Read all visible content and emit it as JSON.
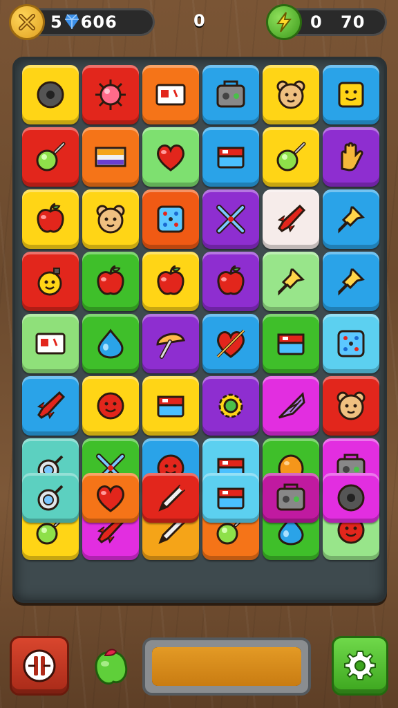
{
  "hud": {
    "left_counter": {
      "icon": "crossed-tools-coin-icon",
      "gem_icon": "blue-gem-icon",
      "prefix": "5",
      "value": "606"
    },
    "center_score": "0",
    "right_counter": {
      "icon": "lightning-bolt-icon",
      "value_a": "0",
      "value_b": "70"
    }
  },
  "board": {
    "rows": 8,
    "cols": 6,
    "tiles": [
      {
        "color": "#ffd516",
        "icon": "donut-icon"
      },
      {
        "color": "#e2261c",
        "icon": "spiky-ball-icon"
      },
      {
        "color": "#f57418",
        "icon": "card-icon"
      },
      {
        "color": "#2aa3e8",
        "icon": "radio-icon"
      },
      {
        "color": "#ffd516",
        "icon": "bear-face-icon"
      },
      {
        "color": "#2aa3e8",
        "icon": "smiley-block-icon"
      },
      {
        "color": "#e2261c",
        "icon": "lollipop-icon"
      },
      {
        "color": "#f57418",
        "icon": "flag-icon"
      },
      {
        "color": "#7ee070",
        "icon": "heart-icon"
      },
      {
        "color": "#2aa3e8",
        "icon": "box-icon"
      },
      {
        "color": "#ffd516",
        "icon": "lollipop-icon"
      },
      {
        "color": "#8e2ed0",
        "icon": "glove-icon"
      },
      {
        "color": "#ffd516",
        "icon": "apple-icon"
      },
      {
        "color": "#ffd516",
        "icon": "bear-face-icon"
      },
      {
        "color": "#f05a14",
        "icon": "dice-icon"
      },
      {
        "color": "#8e2ed0",
        "icon": "crossed-pins-icon"
      },
      {
        "color": "#f6ecea",
        "icon": "rocket-icon"
      },
      {
        "color": "#2aa3e8",
        "icon": "pushpin-icon"
      },
      {
        "color": "#e2261c",
        "icon": "smiley-bomb-icon"
      },
      {
        "color": "#3fbf2a",
        "icon": "apple-icon"
      },
      {
        "color": "#ffd516",
        "icon": "apple-icon"
      },
      {
        "color": "#8e2ed0",
        "icon": "apple-icon"
      },
      {
        "color": "#98e58a",
        "icon": "pushpin-icon"
      },
      {
        "color": "#2aa3e8",
        "icon": "pushpin-icon"
      },
      {
        "color": "#8fe07a",
        "icon": "card-icon"
      },
      {
        "color": "#3fbf2a",
        "icon": "droplet-icon"
      },
      {
        "color": "#8e2ed0",
        "icon": "mushroom-icon"
      },
      {
        "color": "#2aa3e8",
        "icon": "heart-arrow-icon"
      },
      {
        "color": "#3fbf2a",
        "icon": "box-icon"
      },
      {
        "color": "#5cd0f0",
        "icon": "dice-icon"
      },
      {
        "color": "#2aa3e8",
        "icon": "rocket-icon"
      },
      {
        "color": "#ffd516",
        "icon": "smiley-ball-icon"
      },
      {
        "color": "#ffd516",
        "icon": "box-icon"
      },
      {
        "color": "#8e2ed0",
        "icon": "gear-icon"
      },
      {
        "color": "#e22ee0",
        "icon": "shuttlecock-icon"
      },
      {
        "color": "#e2261c",
        "icon": "bear-face-icon"
      },
      {
        "color": "#5cd0c0",
        "icon": "pacifier-icon"
      },
      {
        "color": "#3fbf2a",
        "icon": "crossed-pins-icon"
      },
      {
        "color": "#2aa3e8",
        "icon": "smiley-ball-icon"
      },
      {
        "color": "#5cd0f0",
        "icon": "box-icon"
      },
      {
        "color": "#3fbf2a",
        "icon": "lemon-icon"
      },
      {
        "color": "#e22ee0",
        "icon": "radio-icon"
      },
      {
        "color": "#ffd516",
        "icon": "lollipop-icon"
      },
      {
        "color": "#e22ee0",
        "icon": "rocket-icon"
      },
      {
        "color": "#f5a418",
        "icon": "pen-icon"
      },
      {
        "color": "#f57418",
        "icon": "lollipop-icon"
      },
      {
        "color": "#3fbf2a",
        "icon": "droplet-icon"
      },
      {
        "color": "#98e58a",
        "icon": "smiley-ball-icon"
      }
    ],
    "overlay_tiles": [
      {
        "row": 6,
        "col": 0,
        "color": "#5cd0c0",
        "icon": "pacifier-icon"
      },
      {
        "row": 6,
        "col": 1,
        "color": "#f57418",
        "icon": "heart-icon"
      },
      {
        "row": 6,
        "col": 2,
        "color": "#e2261c",
        "icon": "pen-icon"
      },
      {
        "row": 6,
        "col": 3,
        "color": "#5cd0f0",
        "icon": "box-icon"
      },
      {
        "row": 6,
        "col": 4,
        "color": "#c01aa0",
        "icon": "radio-icon"
      },
      {
        "row": 6,
        "col": 5,
        "color": "#e22ee0",
        "icon": "donut-icon"
      }
    ]
  },
  "bottom": {
    "left_button_icon": "pause-icon",
    "fruit_icon": "green-fruit-icon",
    "progress_fill": 1.0,
    "settings_icon": "gear-icon"
  }
}
